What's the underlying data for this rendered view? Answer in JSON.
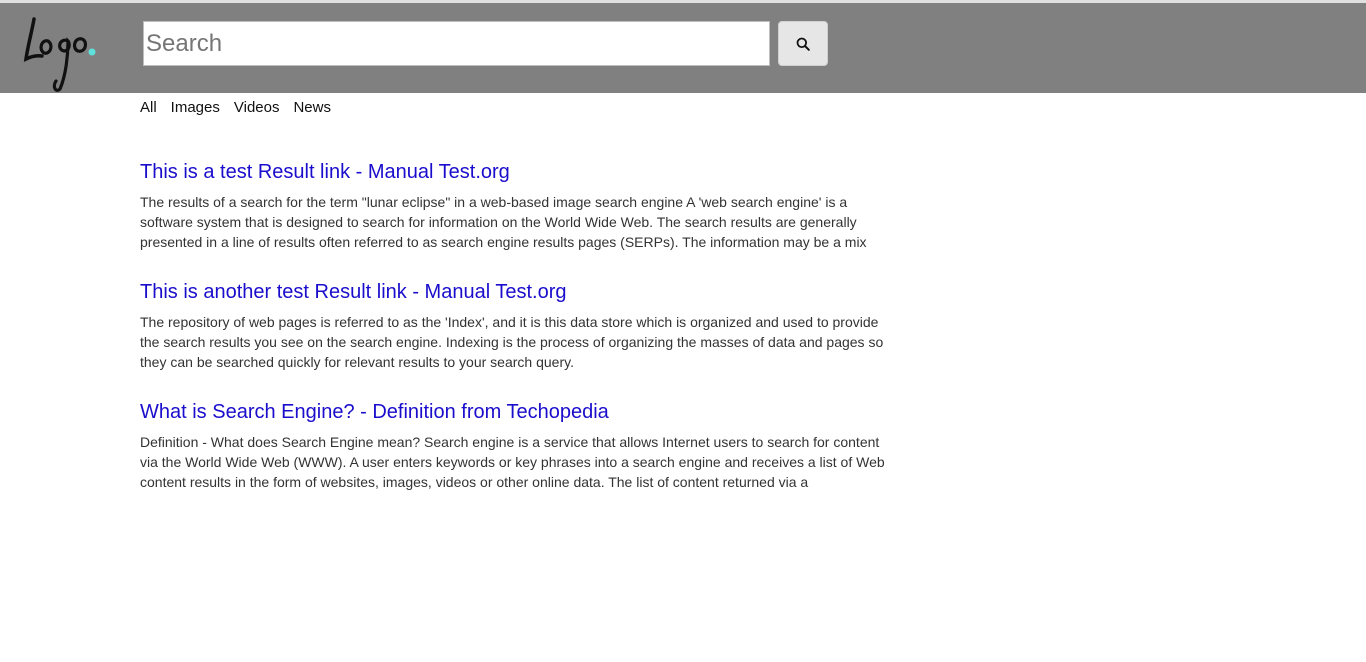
{
  "header": {
    "logo_text": "Logo",
    "accent_color": "#5fe0dc",
    "background_color": "#808080"
  },
  "search": {
    "placeholder": "Search",
    "value": "",
    "button_icon": "search-icon"
  },
  "tabs": [
    {
      "label": "All"
    },
    {
      "label": "Images"
    },
    {
      "label": "Videos"
    },
    {
      "label": "News"
    }
  ],
  "results": [
    {
      "title": "This is a test Result link - Manual Test.org",
      "snippet": "The results of a search for the term \"lunar eclipse\" in a web-based image search engine A 'web search engine' is a software system that is designed to search for information on the World Wide Web. The search results are generally presented in a line of results often referred to as search engine results pages (SERPs). The information may be a mix"
    },
    {
      "title": "This is another test Result link - Manual Test.org",
      "snippet": "The repository of web pages is referred to as the 'Index', and it is this data store which is organized and used to provide the search results you see on the search engine. Indexing is the process of organizing the masses of data and pages so they can be searched quickly for relevant results to your search query."
    },
    {
      "title": "What is Search Engine? - Definition from Techopedia",
      "snippet": "Definition - What does Search Engine mean? Search engine is a service that allows Internet users to search for content via the World Wide Web (WWW). A user enters keywords or key phrases into a search engine and receives a list of Web content results in the form of websites, images, videos or other online data. The list of content returned via a"
    }
  ]
}
